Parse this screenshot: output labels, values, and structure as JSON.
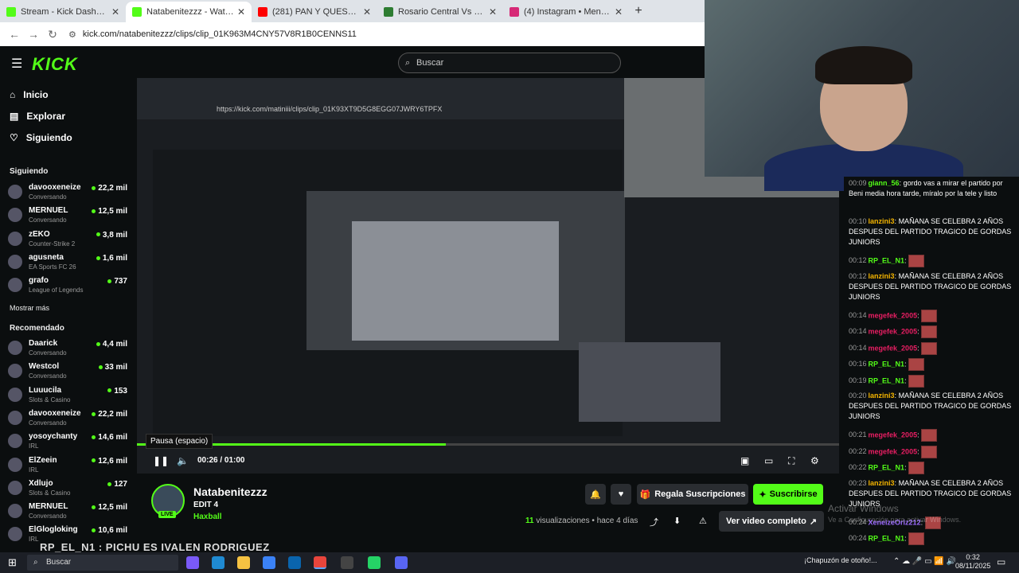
{
  "browser": {
    "tabs": [
      {
        "label": "Stream - Kick Dashboard",
        "color": "#53fc18"
      },
      {
        "label": "Natabenitezzz - Watch clips",
        "color": "#53fc18"
      },
      {
        "label": "(281) PAN Y QUESO DE RIVER",
        "color": "#ff0000"
      },
      {
        "label": "Rosario Central Vs San Lorenzo",
        "color": "#2e7d32"
      },
      {
        "label": "(4) Instagram • Mensajes",
        "color": "#d62976"
      }
    ],
    "url": "kick.com/natabenitezzz/clips/clip_01K963M4CNY57V8R1B0CENNS11"
  },
  "header": {
    "logo": "KICK",
    "search_placeholder": "Buscar"
  },
  "sidebar": {
    "nav": [
      "Inicio",
      "Explorar",
      "Siguiendo"
    ],
    "following_title": "Siguiendo",
    "following": [
      {
        "name": "davooxeneize",
        "category": "Conversando",
        "viewers": "22,2 mil"
      },
      {
        "name": "MERNUEL",
        "category": "Conversando",
        "viewers": "12,5 mil"
      },
      {
        "name": "zEKO",
        "category": "Counter-Strike 2",
        "viewers": "3,8 mil"
      },
      {
        "name": "agusneta",
        "category": "EA Sports FC 26",
        "viewers": "1,6 mil"
      },
      {
        "name": "grafo",
        "category": "League of Legends",
        "viewers": "737"
      }
    ],
    "show_more": "Mostrar más",
    "recommended_title": "Recomendado",
    "recommended": [
      {
        "name": "Daarick",
        "category": "Conversando",
        "viewers": "4,4 mil"
      },
      {
        "name": "Westcol",
        "category": "Conversando",
        "viewers": "33 mil"
      },
      {
        "name": "Luuucila",
        "category": "Slots & Casino",
        "viewers": "153"
      },
      {
        "name": "davooxeneize",
        "category": "Conversando",
        "viewers": "22,2 mil"
      },
      {
        "name": "yosoychanty",
        "category": "IRL",
        "viewers": "14,6 mil"
      },
      {
        "name": "ElZeein",
        "category": "IRL",
        "viewers": "12,6 mil"
      },
      {
        "name": "Xdlujo",
        "category": "Slots & Casino",
        "viewers": "127"
      },
      {
        "name": "MERNUEL",
        "category": "Conversando",
        "viewers": "12,5 mil"
      },
      {
        "name": "ElGlogloking",
        "category": "IRL",
        "viewers": "10,6 mil"
      }
    ]
  },
  "video": {
    "inner_url": "https://kick.com/matiniii/clips/clip_01K93XT9D5G8EGG07JWRY6TPFX",
    "tooltip": "Pausa (espacio)",
    "time": "00:26 / 01:00",
    "progress": 0.44
  },
  "channel": {
    "name": "Natabenitezzz",
    "live": "LIVE",
    "clip_title": "EDIT 4",
    "category": "Haxball",
    "gift_label": "Regala Suscripciones",
    "subscribe_label": "Suscribirse",
    "views_count": "11",
    "views_label": "visualizaciones",
    "age": "hace 4 días",
    "watch_full": "Ver video completo"
  },
  "chat": [
    {
      "time": "00:09",
      "user": "giann_56",
      "color": "#53fc18",
      "text": "gordo vas a mirar el partido por Beni media hora tarde, míralo por la tele y listo",
      "emote": false
    },
    {
      "time": "00:10",
      "user": "lanzini3",
      "color": "#f4b400",
      "text": "MAÑANA SE CELEBRA 2 AÑOS DESPUES DEL PARTIDO TRAGICO DE GORDAS JUNIORS",
      "emote": false
    },
    {
      "time": "00:12",
      "user": "RP_EL_N1",
      "color": "#53fc18",
      "text": "",
      "emote": true
    },
    {
      "time": "00:12",
      "user": "lanzini3",
      "color": "#f4b400",
      "text": "MAÑANA SE CELEBRA 2 AÑOS DESPUES DEL PARTIDO TRAGICO DE GORDAS JUNIORS",
      "emote": false
    },
    {
      "time": "00:14",
      "user": "megefek_2005",
      "color": "#e91e63",
      "text": "",
      "emote": true
    },
    {
      "time": "00:14",
      "user": "megefek_2005",
      "color": "#e91e63",
      "text": "",
      "emote": true
    },
    {
      "time": "00:14",
      "user": "megefek_2005",
      "color": "#e91e63",
      "text": "",
      "emote": true
    },
    {
      "time": "00:16",
      "user": "RP_EL_N1",
      "color": "#53fc18",
      "text": "",
      "emote": true
    },
    {
      "time": "00:19",
      "user": "RP_EL_N1",
      "color": "#53fc18",
      "text": "",
      "emote": true
    },
    {
      "time": "00:20",
      "user": "lanzini3",
      "color": "#f4b400",
      "text": "MAÑANA SE CELEBRA 2 AÑOS DESPUES DEL PARTIDO TRAGICO DE GORDAS JUNIORS",
      "emote": false
    },
    {
      "time": "00:21",
      "user": "megefek_2005",
      "color": "#e91e63",
      "text": "",
      "emote": true
    },
    {
      "time": "00:22",
      "user": "megefek_2005",
      "color": "#e91e63",
      "text": "",
      "emote": true
    },
    {
      "time": "00:22",
      "user": "RP_EL_N1",
      "color": "#53fc18",
      "text": "",
      "emote": true
    },
    {
      "time": "00:23",
      "user": "lanzini3",
      "color": "#f4b400",
      "text": "MAÑANA SE CELEBRA 2 AÑOS DESPUES DEL PARTIDO TRAGICO DE GORDAS JUNIORS",
      "emote": false
    },
    {
      "time": "00:24",
      "user": "XeneizeOriz212",
      "color": "#9c6bff",
      "text": "",
      "emote": true
    },
    {
      "time": "00:24",
      "user": "RP_EL_N1",
      "color": "#53fc18",
      "text": "",
      "emote": true
    }
  ],
  "overlay_text": "RP_EL_N1 : PICHU ES IVALEN RODRIGUEZ",
  "watermark": {
    "title": "Activar Windows",
    "subtitle": "Ve a Configuración para activar Windows."
  },
  "taskbar": {
    "search": "Buscar",
    "tray_text": "¡Chapuzón de otoño!...",
    "time": "0:32",
    "date": "08/11/2025"
  },
  "colors": {
    "accent": "#53fc18",
    "bg": "#0b0e0f"
  }
}
